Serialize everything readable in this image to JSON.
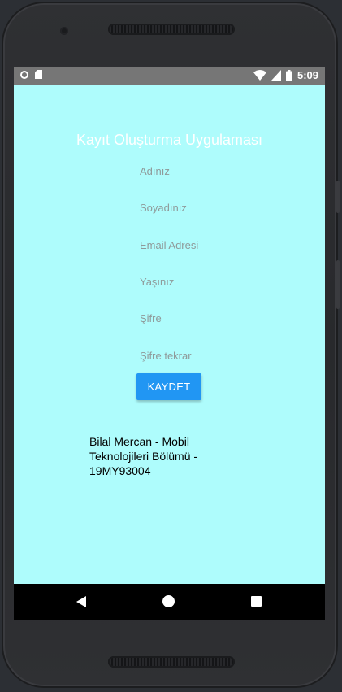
{
  "status_bar": {
    "time": "5:09",
    "icons": [
      "record-icon",
      "sd-card-icon",
      "wifi-icon",
      "signal-icon",
      "battery-icon"
    ]
  },
  "app": {
    "title": "Kayıt Oluşturma Uygulaması",
    "background_color": "#aefcfc",
    "fields": [
      {
        "name": "first-name-field",
        "placeholder": "Adınız",
        "value": ""
      },
      {
        "name": "last-name-field",
        "placeholder": "Soyadınız",
        "value": ""
      },
      {
        "name": "email-field",
        "placeholder": "Email Adresi",
        "value": ""
      },
      {
        "name": "age-field",
        "placeholder": "Yaşınız",
        "value": ""
      },
      {
        "name": "password-field",
        "placeholder": "Şifre",
        "value": ""
      },
      {
        "name": "password-repeat-field",
        "placeholder": "Şifre tekrar",
        "value": ""
      }
    ],
    "save_button_label": "KAYDET",
    "save_button_color": "#2196f3",
    "credit": "Bilal Mercan - Mobil Teknolojileri Bölümü - 19MY93004"
  },
  "nav_bar": {
    "icons": [
      "back-icon",
      "home-icon",
      "recent-apps-icon"
    ]
  }
}
